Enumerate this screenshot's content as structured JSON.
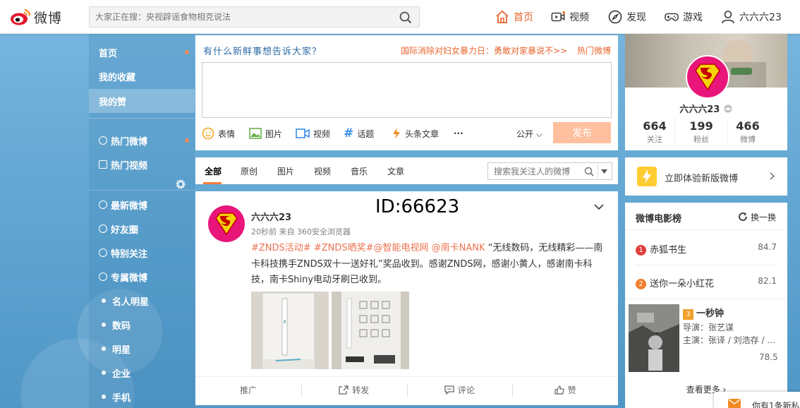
{
  "brand": {
    "name": "微博"
  },
  "search": {
    "placeholder": "大家正在搜：央视辟谣食物相克说法"
  },
  "topnav": [
    {
      "label": "首页",
      "icon": "home-icon",
      "active": true
    },
    {
      "label": "视频",
      "icon": "video-icon"
    },
    {
      "label": "发现",
      "icon": "compass-icon"
    },
    {
      "label": "游戏",
      "icon": "gamepad-icon"
    },
    {
      "label": "六六六23",
      "icon": "user-icon"
    }
  ],
  "leftnav": {
    "top": [
      "首页",
      "我的收藏",
      "我的赞"
    ],
    "middle": [
      "热门微博",
      "热门视频"
    ],
    "groups": [
      "最新微博",
      "好友圈",
      "特别关注",
      "专属微博"
    ],
    "sub": [
      "名人明星",
      "数码",
      "明星",
      "企业",
      "手机"
    ]
  },
  "publisher": {
    "prompt": "有什么新鲜事想告诉大家？",
    "hot_topic": "国际消除对妇女暴力日：勇敢对家暴说不>>",
    "hot_label": "热门微博",
    "tools": [
      "表情",
      "图片",
      "视频",
      "话题",
      "头条文章"
    ],
    "more": "···",
    "visibility": "公开",
    "post_button": "发布"
  },
  "feed_tabs": {
    "tabs": [
      "全部",
      "原创",
      "图片",
      "视频",
      "音乐",
      "文章"
    ],
    "search_placeholder": "搜索我关注人的微博"
  },
  "post": {
    "author": "六六六23",
    "time": "20秒前",
    "source": "来自 360安全浏览器",
    "tags": [
      "#ZNDS活动#",
      "#ZNDS晒奖#",
      "@智能电视网",
      "@南卡NANK"
    ],
    "text": "“无线数码，无线精彩——南卡科技携手ZNDS双十一送好礼”奖品收到。感谢ZNDS网，感谢小黄人，感谢南卡科技，南卡Shiny电动牙刷已收到。",
    "actions": [
      "推广",
      "转发",
      "评论",
      "赞"
    ]
  },
  "watermark": "ID:66623",
  "profile": {
    "nickname": "六六六23",
    "stats": [
      {
        "count": "664",
        "label": "关注"
      },
      {
        "count": "199",
        "label": "粉丝"
      },
      {
        "count": "466",
        "label": "微博"
      }
    ]
  },
  "new_version": {
    "label": "立即体验新版微博"
  },
  "movies": {
    "title": "微博电影榜",
    "switch": "换一换",
    "items": [
      {
        "rank": "1",
        "title": "赤狐书生",
        "score": "84.7",
        "color": "#e03e3e"
      },
      {
        "rank": "2",
        "title": "送你一朵小红花",
        "score": "82.1",
        "color": "#f07d2b"
      },
      {
        "rank": "3",
        "title": "一秒钟",
        "score": "78.5",
        "color": "#f0a02b",
        "director": "导演：张艺谋",
        "cast": "主演：张译 / 刘浩存 / ..."
      }
    ],
    "more": "查看更多 ›"
  },
  "message": {
    "text": "你有1条新私"
  }
}
